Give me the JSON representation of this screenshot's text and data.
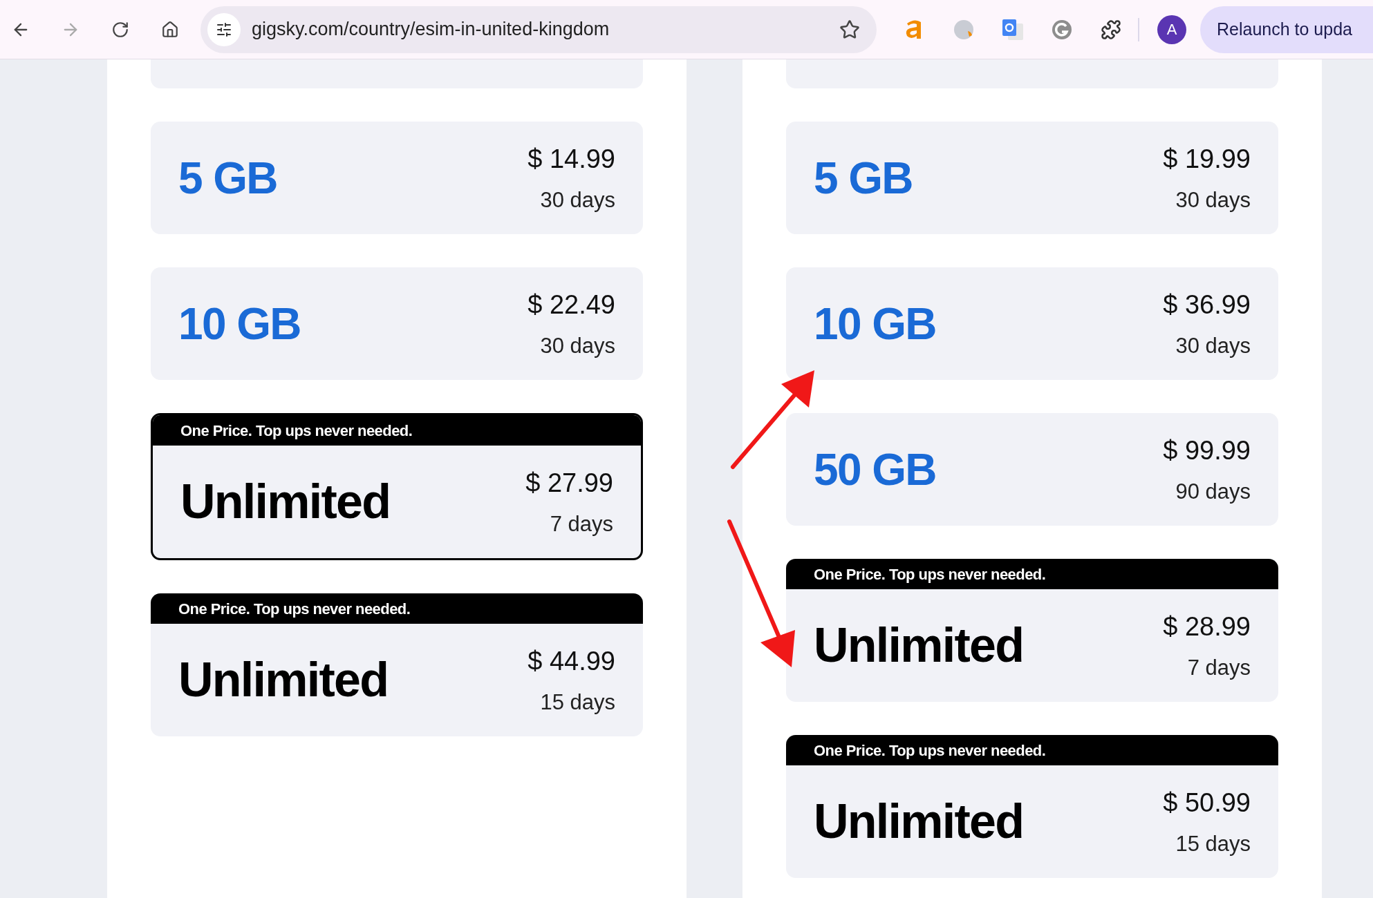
{
  "browser": {
    "url": "gigsky.com/country/esim-in-united-kingdom",
    "avatar_letter": "A",
    "relaunch_button": "Relaunch to upda"
  },
  "columns": [
    {
      "plans": [
        {
          "kind": "data",
          "title": "5 GB",
          "price": "$ 14.99",
          "duration": "30 days",
          "selected": false
        },
        {
          "kind": "data",
          "title": "10 GB",
          "price": "$ 22.49",
          "duration": "30 days",
          "selected": false
        },
        {
          "kind": "unlimited",
          "banner": "One Price. Top ups never needed.",
          "title": "Unlimited",
          "price": "$ 27.99",
          "duration": "7 days",
          "selected": true
        },
        {
          "kind": "unlimited",
          "banner": "One Price. Top ups never needed.",
          "title": "Unlimited",
          "price": "$ 44.99",
          "duration": "15 days",
          "selected": false
        }
      ]
    },
    {
      "plans": [
        {
          "kind": "data",
          "title": "5 GB",
          "price": "$ 19.99",
          "duration": "30 days",
          "selected": false
        },
        {
          "kind": "data",
          "title": "10 GB",
          "price": "$ 36.99",
          "duration": "30 days",
          "selected": false
        },
        {
          "kind": "data",
          "title": "50 GB",
          "price": "$ 99.99",
          "duration": "90 days",
          "selected": false
        },
        {
          "kind": "unlimited",
          "banner": "One Price. Top ups never needed.",
          "title": "Unlimited",
          "price": "$ 28.99",
          "duration": "7 days",
          "selected": false
        },
        {
          "kind": "unlimited",
          "banner": "One Price. Top ups never needed.",
          "title": "Unlimited",
          "price": "$ 50.99",
          "duration": "15 days",
          "selected": false
        }
      ]
    }
  ]
}
